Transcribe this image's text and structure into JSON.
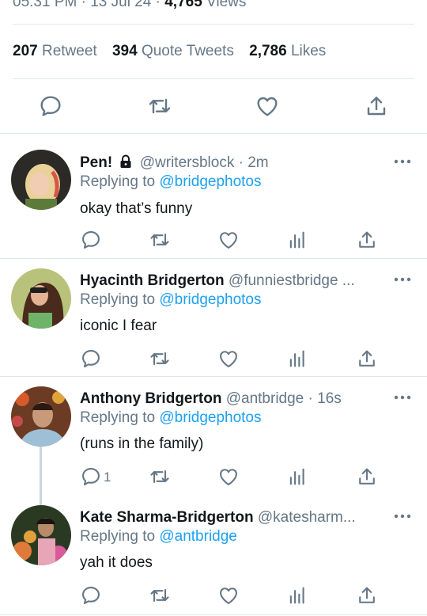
{
  "header": {
    "meta_partial": "05:31 PM · 13 Jul 24 ·",
    "views_count": "4,765",
    "views_label": "Views"
  },
  "stats": {
    "retweets_count": "207",
    "retweets_label": "Retweet",
    "quotes_count": "394",
    "quotes_label": "Quote Tweets",
    "likes_count": "2,786",
    "likes_label": "Likes"
  },
  "tweets": [
    {
      "name": "Pen!",
      "handle": "@writersblock",
      "time": "· 2m",
      "locked": true,
      "replying_label": "Replying to",
      "replying_to": "@bridgephotos",
      "text": "okay that’s funny",
      "reply_count": ""
    },
    {
      "name": "Hyacinth Bridgerton",
      "handle": "@funniestbridge ...",
      "time": "",
      "locked": false,
      "replying_label": "Replying to",
      "replying_to": "@bridgephotos",
      "text": "iconic I fear",
      "reply_count": ""
    },
    {
      "name": "Anthony Bridgerton",
      "handle": "@antbridge",
      "time": "· 16s",
      "locked": false,
      "replying_label": "Replying to",
      "replying_to": "@bridgephotos",
      "text": "(runs in the family)",
      "reply_count": "1"
    },
    {
      "name": "Kate Sharma-Bridgerton",
      "handle": "@katesharm...",
      "time": "",
      "locked": false,
      "replying_label": "Replying to",
      "replying_to": "@antbridge",
      "text": "yah it does",
      "reply_count": ""
    }
  ],
  "colors": {
    "accent": "#1da1f2",
    "secondary_text": "#657786",
    "divider": "#e1e8ed",
    "icon": "#657786"
  },
  "icons": [
    "reply-icon",
    "retweet-icon",
    "like-icon",
    "share-icon",
    "analytics-icon",
    "more-icon",
    "lock-icon"
  ]
}
